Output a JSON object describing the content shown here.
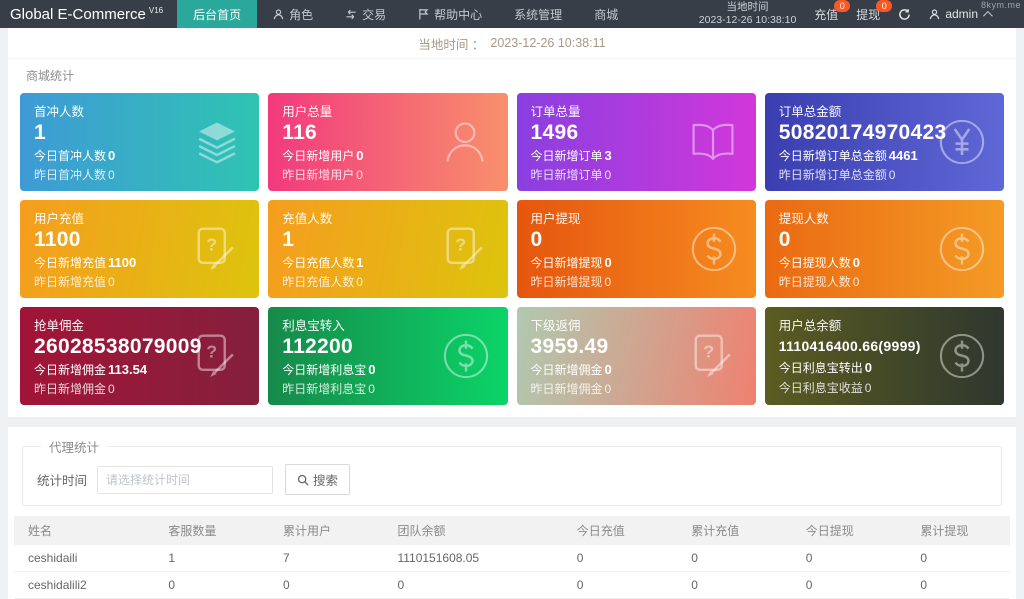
{
  "navbar": {
    "brand": "Global E-Commerce",
    "brand_sup": "V16",
    "menu": [
      {
        "label": "后台首页",
        "icon": null,
        "active": true
      },
      {
        "label": "角色",
        "icon": "user",
        "active": false
      },
      {
        "label": "交易",
        "icon": "exchange",
        "active": false
      },
      {
        "label": "帮助中心",
        "icon": "flag",
        "active": false
      },
      {
        "label": "系统管理",
        "icon": null,
        "active": false
      },
      {
        "label": "商城",
        "icon": null,
        "active": false
      }
    ],
    "local_time_label": "当地时间",
    "local_time_value": "2023-12-26 10:38:10",
    "recharge_label": "充值",
    "recharge_badge": "0",
    "withdraw_label": "提现",
    "withdraw_badge": "0",
    "username": "admin",
    "watermark": "8kym.me"
  },
  "timebar": {
    "label": "当地时间 ：",
    "value": "2023-12-26 10:38:11"
  },
  "stats": {
    "section_title": "商城统计",
    "cards": [
      {
        "title": "首冲人数",
        "value": "1",
        "line2_label": "今日首冲人数",
        "line2_value": "0",
        "line3_label": "昨日首冲人数",
        "line3_value": "0",
        "icon": "layers",
        "gradient": {
          "angle": "90deg",
          "from": "#3e9ad6",
          "to": "#2fc4b2"
        }
      },
      {
        "title": "用户总量",
        "value": "116",
        "line2_label": "今日新增用户",
        "line2_value": "0",
        "line3_label": "昨日新增用户",
        "line3_value": "0",
        "icon": "person",
        "gradient": {
          "angle": "90deg",
          "from": "#f2397e",
          "to": "#f8906c"
        }
      },
      {
        "title": "订单总量",
        "value": "1496",
        "line2_label": "今日新增订单",
        "line2_value": "3",
        "line3_label": "昨日新增订单",
        "line3_value": "0",
        "icon": "book",
        "gradient": {
          "angle": "90deg",
          "from": "#8a3fe0",
          "to": "#d237da"
        }
      },
      {
        "title": "订单总金额",
        "value": "50820174970423",
        "line2_label": "今日新增订单总金额",
        "line2_value": "4461",
        "line3_label": "昨日新增订单总金额",
        "line3_value": "0",
        "icon": "yen",
        "gradient": {
          "angle": "90deg",
          "from": "#3a3eb0",
          "to": "#6067d6"
        }
      },
      {
        "title": "用户充值",
        "value": "1100",
        "line2_label": "今日新增充值",
        "line2_value": "1100",
        "line3_label": "昨日新增充值",
        "line3_value": "0",
        "icon": "doc",
        "gradient": {
          "angle": "100deg",
          "from": "#f59d1f",
          "to": "#ddc40d"
        }
      },
      {
        "title": "充值人数",
        "value": "1",
        "line2_label": "今日充值人数",
        "line2_value": "1",
        "line3_label": "昨日充值人数",
        "line3_value": "0",
        "icon": "doc",
        "gradient": {
          "angle": "100deg",
          "from": "#f59d1f",
          "to": "#ddc40d"
        }
      },
      {
        "title": "用户提现",
        "value": "0",
        "line2_label": "今日新增提现",
        "line2_value": "0",
        "line3_label": "昨日新增提现",
        "line3_value": "0",
        "icon": "dollar",
        "gradient": {
          "angle": "90deg",
          "from": "#e5560e",
          "to": "#f68c20"
        }
      },
      {
        "title": "提现人数",
        "value": "0",
        "line2_label": "今日提现人数",
        "line2_value": "0",
        "line3_label": "昨日提现人数",
        "line3_value": "0",
        "icon": "dollar",
        "gradient": {
          "angle": "90deg",
          "from": "#ea6a12",
          "to": "#f49b25"
        }
      },
      {
        "title": "抢单佣金",
        "value": "26028538079009",
        "line2_label": "今日新增佣金",
        "line2_value": "113.54",
        "line3_label": "昨日新增佣金",
        "line3_value": "0",
        "icon": "doc",
        "gradient": {
          "angle": "90deg",
          "from": "#a11438",
          "to": "#84203c"
        }
      },
      {
        "title": "利息宝转入",
        "value": "112200",
        "line2_label": "今日新增利息宝",
        "line2_value": "0",
        "line3_label": "昨日新增利息宝",
        "line3_value": "0",
        "icon": "dollar",
        "gradient": {
          "angle": "90deg",
          "from": "#16894a",
          "to": "#0bd468"
        }
      },
      {
        "title": "下级返佣",
        "value": "3959.49",
        "line2_label": "今日新增佣金",
        "line2_value": "0",
        "line3_label": "昨日新增佣金",
        "line3_value": "0",
        "icon": "doc",
        "gradient": {
          "angle": "100deg",
          "from": "#b0c9b0",
          "to": "#ef8170"
        }
      },
      {
        "title": "用户总余额",
        "value": "1110416400.66(9999)",
        "value_small": true,
        "line2_label": "今日利息宝转出",
        "line2_value": "0",
        "line3_label": "今日利息宝收益",
        "line3_value": "0",
        "icon": "dollar",
        "gradient": {
          "angle": "90deg",
          "from": "#5a5c20",
          "to": "#2f372f"
        }
      }
    ]
  },
  "agent": {
    "section_title": "代理统计",
    "filter_label": "统计时间",
    "filter_placeholder": "请选择统计时间",
    "search_label": "搜索"
  },
  "table": {
    "headers": [
      "姓名",
      "客服数量",
      "累计用户",
      "团队余额",
      "今日充值",
      "累计充值",
      "今日提现",
      "累计提现"
    ],
    "col_widths": [
      "14.5%",
      "11.5%",
      "11.5%",
      "18%",
      "11.5%",
      "11.5%",
      "11.5%",
      "10%"
    ],
    "rows": [
      [
        "ceshidaili",
        "1",
        "7",
        "1110151608.05",
        "0",
        "0",
        "0",
        "0"
      ],
      [
        "ceshidalili2",
        "0",
        "0",
        "0",
        "0",
        "0",
        "0",
        "0"
      ]
    ]
  }
}
